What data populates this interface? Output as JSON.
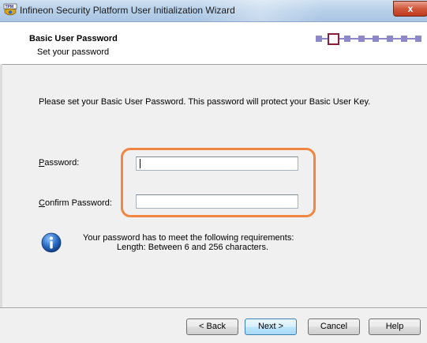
{
  "window": {
    "title": "Infineon Security Platform User Initialization Wizard",
    "close_symbol": "x",
    "app_icon": "tpm-shield-icon"
  },
  "header": {
    "title": "Basic User Password",
    "subtitle": "Set your password",
    "steps_total": 8,
    "active_step": 2
  },
  "content": {
    "intro": "Please set your Basic User Password. This password will protect your Basic User Key.",
    "password_label": "Password:",
    "password_value": "",
    "confirm_label": "Confirm Password:",
    "confirm_value": "",
    "info_icon": "info-icon",
    "requirements_line1": "Your password has to meet the following requirements:",
    "requirements_line2": "Length: Between 6 and 256 characters."
  },
  "buttons": {
    "back": "< Back",
    "next": "Next >",
    "cancel": "Cancel",
    "help": "Help"
  },
  "colors": {
    "highlight": "#f08641",
    "step": "#8d88c8",
    "active_step_border": "#8a1f3c",
    "info": "#2a6cc4"
  }
}
